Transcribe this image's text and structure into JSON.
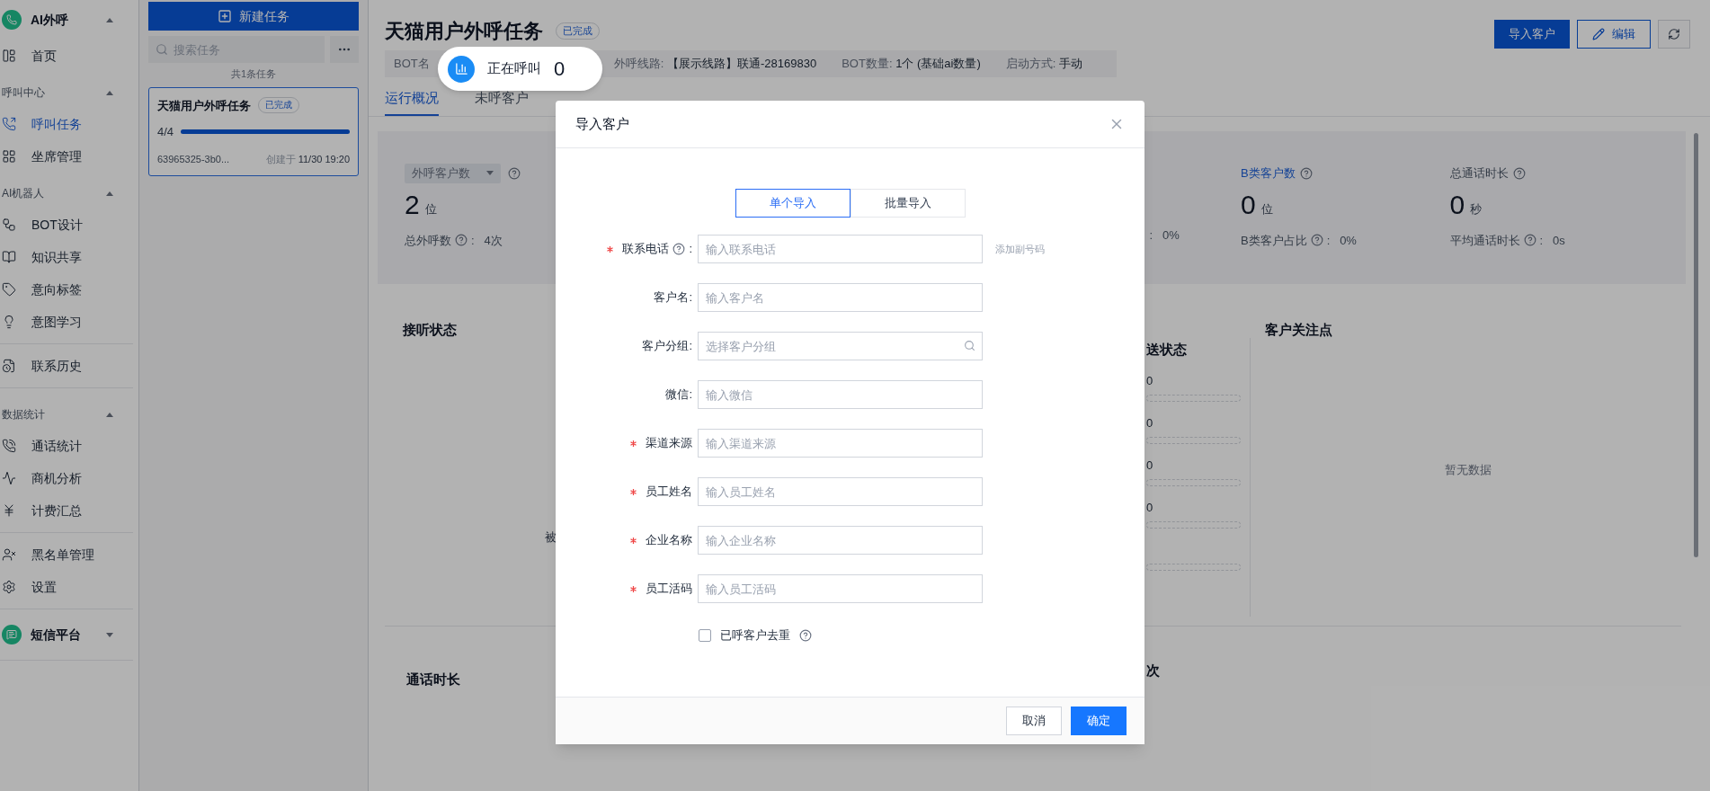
{
  "sidebar": {
    "items": [
      {
        "kind": "app",
        "label": "AI外呼",
        "expanded": true
      },
      {
        "kind": "item",
        "label": "首页",
        "selected": false
      },
      {
        "kind": "group",
        "label": "呼叫中心",
        "expanded": true
      },
      {
        "kind": "item",
        "label": "呼叫任务",
        "selected": true
      },
      {
        "kind": "item",
        "label": "坐席管理",
        "selected": false
      },
      {
        "kind": "group",
        "label": "AI机器人",
        "expanded": true
      },
      {
        "kind": "item",
        "label": "BOT设计",
        "selected": false
      },
      {
        "kind": "item",
        "label": "知识共享",
        "selected": false
      },
      {
        "kind": "item",
        "label": "意向标签",
        "selected": false
      },
      {
        "kind": "item",
        "label": "意图学习",
        "selected": false
      },
      {
        "kind": "divider"
      },
      {
        "kind": "item",
        "label": "联系历史",
        "selected": false
      },
      {
        "kind": "divider"
      },
      {
        "kind": "group",
        "label": "数据统计",
        "expanded": true
      },
      {
        "kind": "item",
        "label": "通话统计",
        "selected": false
      },
      {
        "kind": "item",
        "label": "商机分析",
        "selected": false
      },
      {
        "kind": "item",
        "label": "计费汇总",
        "selected": false
      },
      {
        "kind": "divider"
      },
      {
        "kind": "item",
        "label": "黑名单管理",
        "selected": false
      },
      {
        "kind": "item",
        "label": "设置",
        "selected": false
      },
      {
        "kind": "divider"
      },
      {
        "kind": "app",
        "label": "短信平台",
        "expanded": false
      },
      {
        "kind": "divider"
      }
    ]
  },
  "task_panel": {
    "new_button": "新建任务",
    "search": {
      "placeholder": "搜索任务"
    },
    "count": "共1条任务",
    "tasks": [
      {
        "title": "天猫用户外呼任务",
        "status": "已完成",
        "progress": "4/4",
        "level": 1,
        "id": "63965325-3b0...",
        "created_label": "创建于",
        "created": "11/30 19:20",
        "selected": true
      }
    ]
  },
  "header": {
    "title": "天猫用户外呼任务",
    "status": "已完成",
    "buttons": [
      {
        "kind": "primary",
        "label": "导入客户"
      },
      {
        "kind": "outline",
        "label": "编辑"
      },
      {
        "kind": "refresh"
      }
    ],
    "info": [
      {
        "label": "BOT名"
      },
      {
        "label": "外呼线路:",
        "value": "【展示线路】联通-28169830"
      },
      {
        "label": "BOT数量:",
        "value": "1个 (基础ai数量)"
      },
      {
        "label": "启动方式:",
        "value": "手动"
      }
    ]
  },
  "call_pill": {
    "label": "正在呼叫",
    "count": "0"
  },
  "tabs": [
    {
      "label": "运行概况",
      "selected": true
    },
    {
      "label": "未呼客户",
      "selected": false
    }
  ],
  "stats": [
    {
      "kind": "select",
      "label": "外呼客户数",
      "value": "2",
      "unit": "位",
      "sub_label": "总外呼数",
      "colon": ":",
      "sub_value": "4次"
    },
    {
      "kind": "covered",
      "colon": ":",
      "sub_value": "0%"
    },
    {
      "kind": "link",
      "label": "B类客户数",
      "value": "0",
      "unit": "位",
      "sub_label": "B类客户占比",
      "colon": ":",
      "sub_value": "0%"
    },
    {
      "kind": "plain",
      "label": "总通话时长",
      "value": "0",
      "unit": "秒",
      "sub_label": "平均通话时长",
      "colon": ":",
      "sub_value": "0s"
    }
  ],
  "answer_panel": {
    "title": "接听状态",
    "legend": "被"
  },
  "send_panel": {
    "title": "送状态",
    "rows": [
      {
        "value": "0",
        "level": 0
      },
      {
        "value": "0",
        "level": 0
      },
      {
        "value": "0",
        "level": 0
      },
      {
        "value": "0",
        "level": 0
      },
      {
        "level": 0
      }
    ]
  },
  "focus_panel": {
    "title": "客户关注点",
    "empty": "暂无数据"
  },
  "duration_panel": {
    "title": "通话时长"
  },
  "count_panel": {
    "title": "次"
  },
  "dialog": {
    "title": "导入客户",
    "tabs": [
      {
        "label": "单个导入",
        "selected": true
      },
      {
        "label": "批量导入",
        "selected": false
      }
    ],
    "fields": [
      {
        "label": "联系电话",
        "required": true,
        "help": true,
        "colon": ":",
        "placeholder": "输入联系电话",
        "extra": "添加副号码",
        "kind": "text"
      },
      {
        "label": "客户名:",
        "required": false,
        "help": false,
        "placeholder": "输入客户名",
        "kind": "text"
      },
      {
        "label": "客户分组:",
        "required": false,
        "help": false,
        "placeholder": "选择客户分组",
        "kind": "search"
      },
      {
        "label": "微信:",
        "required": false,
        "help": false,
        "placeholder": "输入微信",
        "kind": "text"
      },
      {
        "label": "渠道来源",
        "required": true,
        "help": false,
        "placeholder": "输入渠道来源",
        "kind": "text"
      },
      {
        "label": "员工姓名",
        "required": true,
        "help": false,
        "placeholder": "输入员工姓名",
        "kind": "text"
      },
      {
        "label": "企业名称",
        "required": true,
        "help": false,
        "placeholder": "输入企业名称",
        "kind": "text"
      },
      {
        "label": "员工活码",
        "required": true,
        "help": false,
        "placeholder": "输入员工活码",
        "kind": "text"
      }
    ],
    "checkbox": {
      "label": "已呼客户去重",
      "checked": false,
      "help": true
    },
    "buttons": [
      {
        "kind": "secondary",
        "label": "取消"
      },
      {
        "kind": "primary",
        "label": "确定"
      }
    ]
  }
}
